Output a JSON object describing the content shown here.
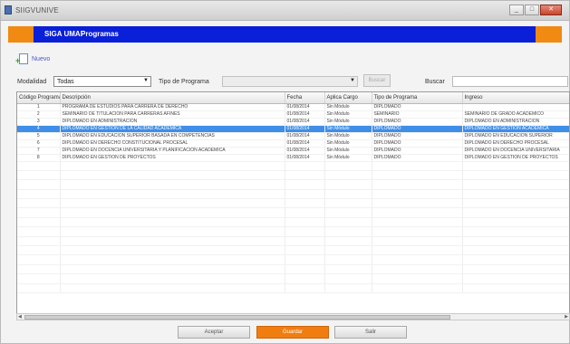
{
  "window": {
    "title": "SIIGVUNIVE"
  },
  "appbar": {
    "brand": "SIGA UMAF",
    "module": "Programas"
  },
  "toolbar": {
    "new_label": "Nuevo"
  },
  "filters": {
    "unit_label": "Modalidad",
    "unit_value": "Todas",
    "type_label": "Tipo de Programa",
    "type_value": "",
    "type_button": "Buscar",
    "search_label": "Buscar",
    "search_value": ""
  },
  "table": {
    "columns": [
      "Código Programa",
      "Descripción",
      "Fecha",
      "Aplica Cargo",
      "Tipo de Programa",
      "Ingreso"
    ],
    "rows": [
      [
        "1",
        "PROGRAMA DE ESTUDIOS PARA CARRERA DE DERECHO",
        "01/08/2014",
        "Sin Módulo",
        "DIPLOMADO",
        ""
      ],
      [
        "2",
        "SEMINARIO DE TITULACION PARA CARRERAS AFINES",
        "01/08/2014",
        "Sin Módulo",
        "SEMINARIO",
        "SEMINARIO DE GRADO ACADÉMICO"
      ],
      [
        "3",
        "DIPLOMADO EN ADMINISTRACION",
        "01/08/2014",
        "Sin Módulo",
        "DIPLOMADO",
        "DIPLOMADO EN ADMINISTRACION"
      ],
      [
        "4",
        "DIPLOMADO EN GESTION DE LA CALIDAD ACADÉMICA",
        "01/08/2014",
        "Sin Módulo",
        "DIPLOMADO",
        "DIPLOMADO EN GESTION ACADÉMICA"
      ],
      [
        "5",
        "DIPLOMADO EN EDUCACION SUPERIOR BASADA EN COMPETENCIAS",
        "01/08/2014",
        "Sin Módulo",
        "DIPLOMADO",
        "DIPLOMADO EN EDUCACION SUPERIOR"
      ],
      [
        "6",
        "DIPLOMADO EN DERECHO CONSTITUCIONAL PROCESAL",
        "01/08/2014",
        "Sin Módulo",
        "DIPLOMADO",
        "DIPLOMADO EN DERECHO PROCESAL"
      ],
      [
        "7",
        "DIPLOMADO EN DOCENCIA UNIVERSITARIA Y PLANIFICACION ACADÉMICA",
        "01/08/2014",
        "Sin Módulo",
        "DIPLOMADO",
        "DIPLOMADO EN DOCENCIA UNIVERSITARIA"
      ],
      [
        "8",
        "DIPLOMADO EN GESTION DE PROYECTOS",
        "01/08/2014",
        "Sin Módulo",
        "DIPLOMADO",
        "DIPLOMADO EN GESTION DE PROYECTOS"
      ]
    ],
    "selected_index": 3
  },
  "footer": {
    "btn_left": "Aceptar",
    "btn_mid": "Guardar",
    "btn_right": "Salir"
  }
}
